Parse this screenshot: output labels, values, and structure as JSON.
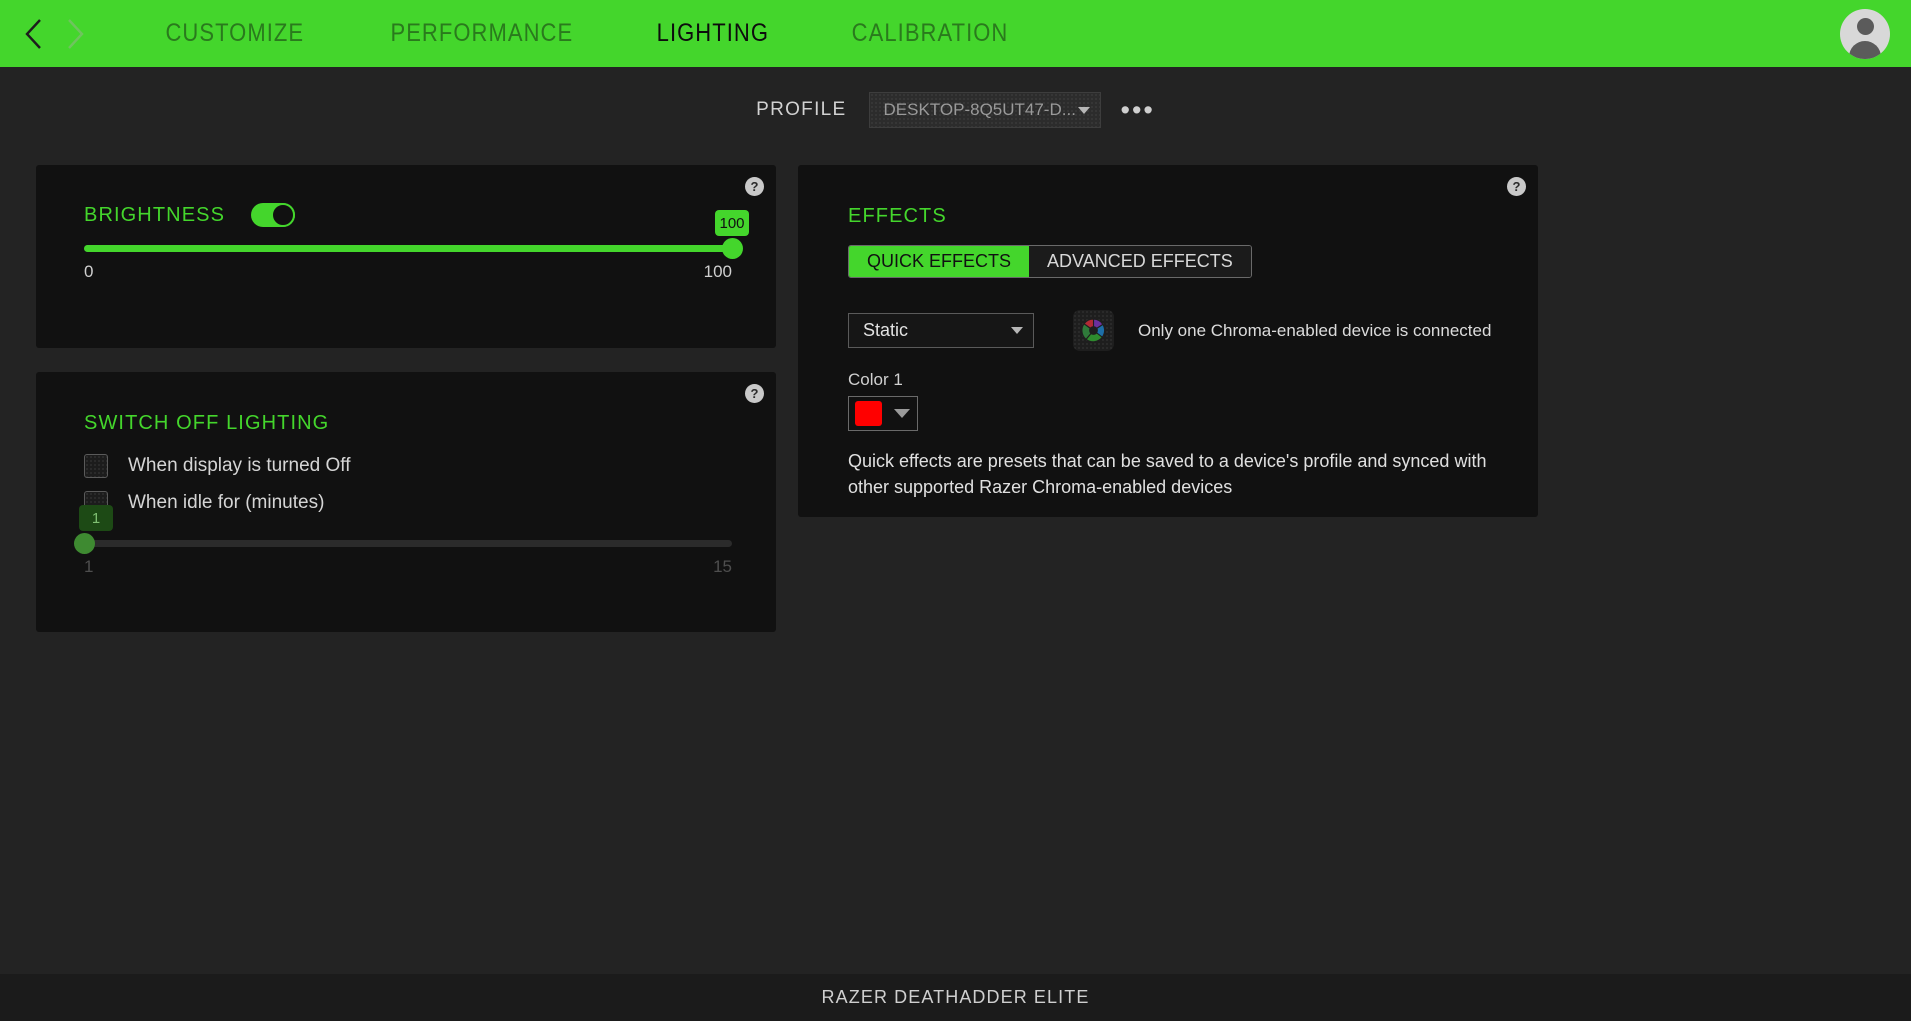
{
  "nav": {
    "back_icon": "chevron-left-icon",
    "forward_icon": "chevron-right-icon",
    "tabs": [
      {
        "label": "CUSTOMIZE",
        "active": false
      },
      {
        "label": "PERFORMANCE",
        "active": false
      },
      {
        "label": "LIGHTING",
        "active": true
      },
      {
        "label": "CALIBRATION",
        "active": false
      }
    ],
    "avatar_icon": "user-avatar-icon",
    "accent_color": "#44d62c",
    "active_tab_color": "#0d0d0d",
    "inactive_tab_color": "#2a7a1d"
  },
  "profile": {
    "label": "PROFILE",
    "selected": "DESKTOP-8Q5UT47-D...",
    "more_label": "•••",
    "dropdown_icon": "chevron-down-icon"
  },
  "brightness": {
    "title": "BRIGHTNESS",
    "help_label": "?",
    "toggle_on": true,
    "value": "100",
    "min_label": "0",
    "max_label": "100",
    "percent": 100
  },
  "switch_off": {
    "title": "SWITCH OFF LIGHTING",
    "help_label": "?",
    "options": [
      {
        "label": "When display is turned Off",
        "checked": false
      },
      {
        "label": "When idle for (minutes)",
        "checked": false
      }
    ],
    "idle_value": "1",
    "idle_min_label": "1",
    "idle_max_label": "15",
    "idle_percent": 0,
    "enabled": false
  },
  "effects": {
    "title": "EFFECTS",
    "help_label": "?",
    "tabs": [
      {
        "label": "QUICK EFFECTS",
        "active": true
      },
      {
        "label": "ADVANCED EFFECTS",
        "active": false
      }
    ],
    "effect_selected": "Static",
    "chroma_icon": "chroma-pinwheel-icon",
    "chroma_note": "Only one Chroma-enabled device is connected",
    "color_label": "Color 1",
    "color_value": "#FF0000",
    "description": "Quick effects are presets that can be saved to a device's profile and synced with other supported Razer Chroma-enabled devices"
  },
  "footer": {
    "device_name": "RAZER DEATHADDER ELITE"
  }
}
